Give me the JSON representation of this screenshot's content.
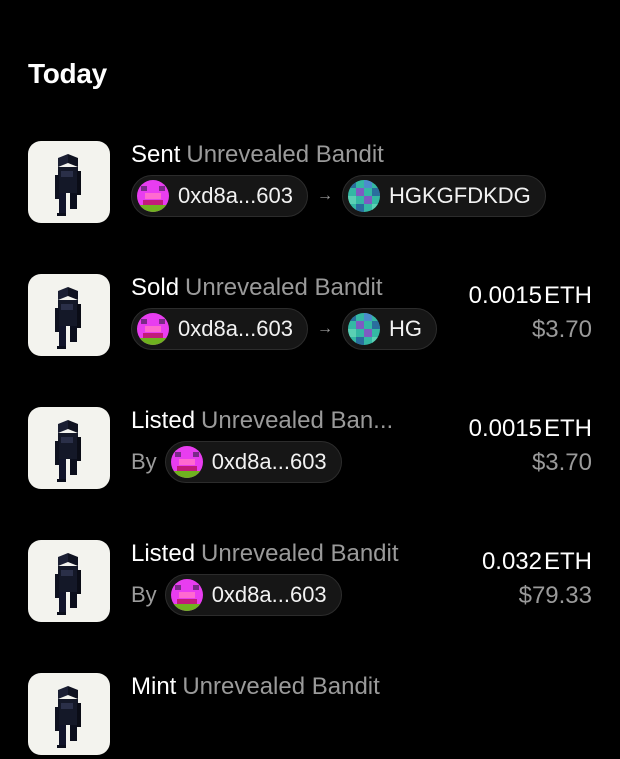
{
  "section_title": "Today",
  "arrow": "→",
  "rows": [
    {
      "verb": "Sent",
      "item": "Unrevealed Bandit",
      "from": "0xd8a...603",
      "to": "HGKGFDKDG"
    },
    {
      "verb": "Sold",
      "item": "Unrevealed Bandit",
      "from": "0xd8a...603",
      "to": "HG",
      "price_eth": "0.0015",
      "unit": "ETH",
      "price_usd": "$3.70"
    },
    {
      "verb": "Listed",
      "item": "Unrevealed Ban...",
      "by_label": "By",
      "by": "0xd8a...603",
      "price_eth": "0.0015",
      "unit": "ETH",
      "price_usd": "$3.70"
    },
    {
      "verb": "Listed",
      "item": "Unrevealed Bandit",
      "by_label": "By",
      "by": "0xd8a...603",
      "price_eth": "0.032",
      "unit": "ETH",
      "price_usd": "$79.33"
    },
    {
      "verb": "Mint",
      "item": "Unrevealed Bandit"
    }
  ],
  "colors": {
    "pink_avatar": "#e83df0",
    "teal_avatar": "#34b8a4",
    "thumb_bg": "#f3f3ee"
  }
}
